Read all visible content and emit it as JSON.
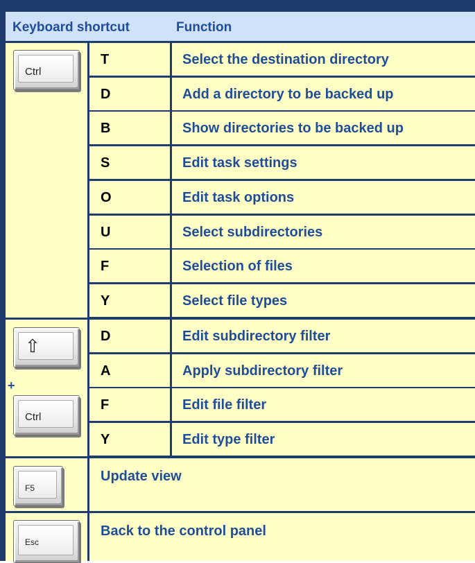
{
  "header": {
    "col1": "Keyboard shortcut",
    "col2": "Function"
  },
  "keycaps": {
    "ctrl": "Ctrl",
    "shift_symbol": "⇧",
    "f5": "F5",
    "esc": "Esc",
    "plus": "+"
  },
  "ctrl_group": [
    {
      "key": "T",
      "function": "Select the destination directory"
    },
    {
      "key": "D",
      "function": "Add a directory to be backed up"
    },
    {
      "key": "B",
      "function": "Show directories to be backed up"
    },
    {
      "key": "S",
      "function": "Edit task settings"
    },
    {
      "key": "O",
      "function": "Edit task options"
    },
    {
      "key": "U",
      "function": "Select subdirectories"
    },
    {
      "key": "F",
      "function": "Selection of files"
    },
    {
      "key": "Y",
      "function": "Select file types"
    }
  ],
  "shift_ctrl_group": [
    {
      "key": "D",
      "function": "Edit subdirectory filter"
    },
    {
      "key": "A",
      "function": "Apply subdirectory filter"
    },
    {
      "key": "F",
      "function": "Edit file filter"
    },
    {
      "key": "Y",
      "function": "Edit type filter"
    }
  ],
  "single_keys": [
    {
      "function": "Update view"
    },
    {
      "function": "Back to the control panel"
    }
  ]
}
